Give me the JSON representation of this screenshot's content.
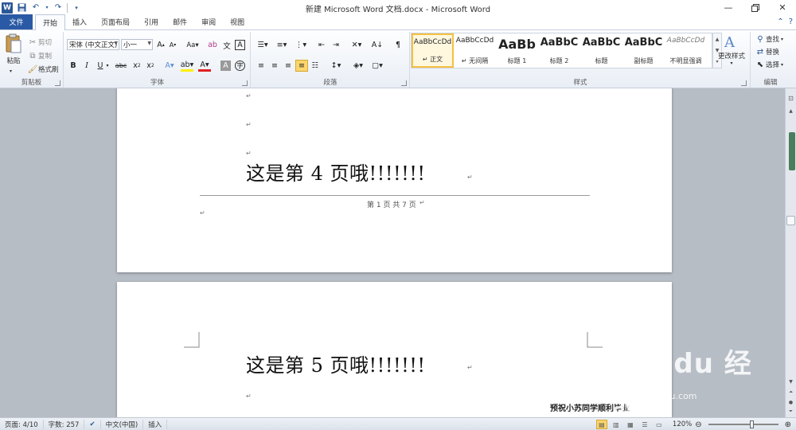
{
  "window": {
    "title": "新建 Microsoft Word 文档.docx - Microsoft Word",
    "app_icon": "W"
  },
  "tabs": [
    {
      "label": "文件"
    },
    {
      "label": "开始"
    },
    {
      "label": "插入"
    },
    {
      "label": "页面布局"
    },
    {
      "label": "引用"
    },
    {
      "label": "邮件"
    },
    {
      "label": "审阅"
    },
    {
      "label": "视图"
    }
  ],
  "ribbon": {
    "clipboard": {
      "label": "剪贴板",
      "paste": "粘贴",
      "cut": "剪切",
      "copy": "复制",
      "format_painter": "格式刷"
    },
    "font": {
      "label": "字体",
      "font_name": "宋体 (中文正文)",
      "font_size": "小一"
    },
    "paragraph": {
      "label": "段落"
    },
    "styles": {
      "label": "样式",
      "items": [
        {
          "sample": "AaBbCcDd",
          "name": "↵ 正文"
        },
        {
          "sample": "AaBbCcDd",
          "name": "↵ 无间隔"
        },
        {
          "sample": "AaBb",
          "name": "标题 1"
        },
        {
          "sample": "AaBbC",
          "name": "标题 2"
        },
        {
          "sample": "AaBbC",
          "name": "标题"
        },
        {
          "sample": "AaBbC",
          "name": "副标题"
        },
        {
          "sample": "AaBbCcDd",
          "name": "不明显强调"
        }
      ],
      "change_styles": "更改样式"
    },
    "editing": {
      "label": "编辑",
      "find": "查找",
      "replace": "替换",
      "select": "选择"
    }
  },
  "document": {
    "page1_heading": "这是第 4 页哦!!!!!!!",
    "page1_footer": "第 1 页 共 7 页",
    "page2_heading": "这是第 5 页哦!!!!!!!",
    "paragraph_mark": "↵",
    "bottom_text": "预祝小苏同学顺利毕业"
  },
  "watermark": {
    "brand": "Bai du 经验",
    "url": "jingyan.baidu.com"
  },
  "status": {
    "page": "页面: 4/10",
    "words": "字数: 257",
    "language": "中文(中国)",
    "mode": "插入",
    "zoom": "120%"
  }
}
